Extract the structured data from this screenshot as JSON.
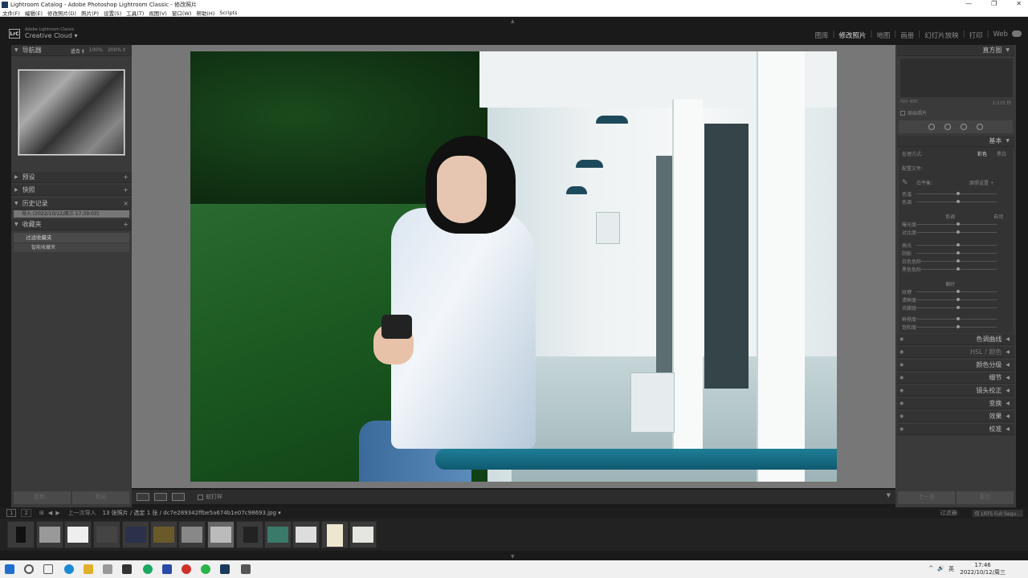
{
  "window": {
    "title": "Lightroom Catalog - Adobe Photoshop Lightroom Classic - 修改照片",
    "controls": [
      "—",
      "❐",
      "✕"
    ]
  },
  "menu": [
    "文件(F)",
    "编辑(E)",
    "修改照片(D)",
    "照片(P)",
    "设置(S)",
    "工具(T)",
    "视图(V)",
    "窗口(W)",
    "帮助(H)",
    "Scripts"
  ],
  "identity": {
    "logo": "LrC",
    "small": "Adobe Lightroom Classic",
    "main": "Creative Cloud ▾"
  },
  "modules": [
    "图库",
    "修改照片",
    "地图",
    "画册",
    "幻灯片放映",
    "打印",
    "Web"
  ],
  "active_module": "修改照片",
  "left_panel": {
    "navigator": "导航器",
    "nav_zoom": [
      "适合 ‡",
      "100%",
      "200% ‡"
    ],
    "presets": "预设",
    "snapshots": "快照",
    "history": "历史记录",
    "history_item": "导入 (2022/10/12/周三 17:39:03)",
    "collections": "收藏夹",
    "collection_filter": "过滤收藏夹",
    "smart_collections": "智能收藏夹",
    "copy_btn": "复制...",
    "paste_btn": "粘贴"
  },
  "toolbar": {
    "soft_proof": "软打样"
  },
  "right_panel": {
    "histogram": "直方图",
    "histo_left": "ISO 400",
    "histo_right": "1/125 秒",
    "original": "原始照片",
    "basic": "基本",
    "treatment": "处理方式:",
    "color": "彩色",
    "bw": "黑白",
    "profile": "配置文件:",
    "wb": "白平衡:",
    "wb_value": "原照设置 ÷",
    "temp": "色温",
    "tint": "色调",
    "tone": "色调",
    "auto": "自动",
    "exposure": "曝光度",
    "contrast": "对比度",
    "highlights": "高光",
    "shadows": "阴影",
    "whites": "白色色阶",
    "blacks": "黑色色阶",
    "presence": "偏好",
    "texture": "纹理",
    "clarity": "清晰度",
    "dehaze": "去朦胧",
    "vibrance": "鲜艳度",
    "saturation": "饱和度",
    "sections": [
      "色调曲线",
      "HSL / 颜色",
      "颜色分级",
      "细节",
      "镜头校正",
      "变换",
      "效果",
      "校准"
    ],
    "prev_btn": "上一张",
    "reset_btn": "复位"
  },
  "filmbar": {
    "page1": "1",
    "page2": "2",
    "source": "上一次导入",
    "count": "13 张照片 / 选定 1 张 / dc7e289342ffbe5a674b1e07c98693.jpg ▾",
    "filter": "过滤器:",
    "filter_value": "仅 LRTS Full Sequ..."
  },
  "clock": {
    "time": "17:46",
    "date": "2022/10/12/周三"
  },
  "tray": [
    "^",
    "🔊",
    "英"
  ]
}
